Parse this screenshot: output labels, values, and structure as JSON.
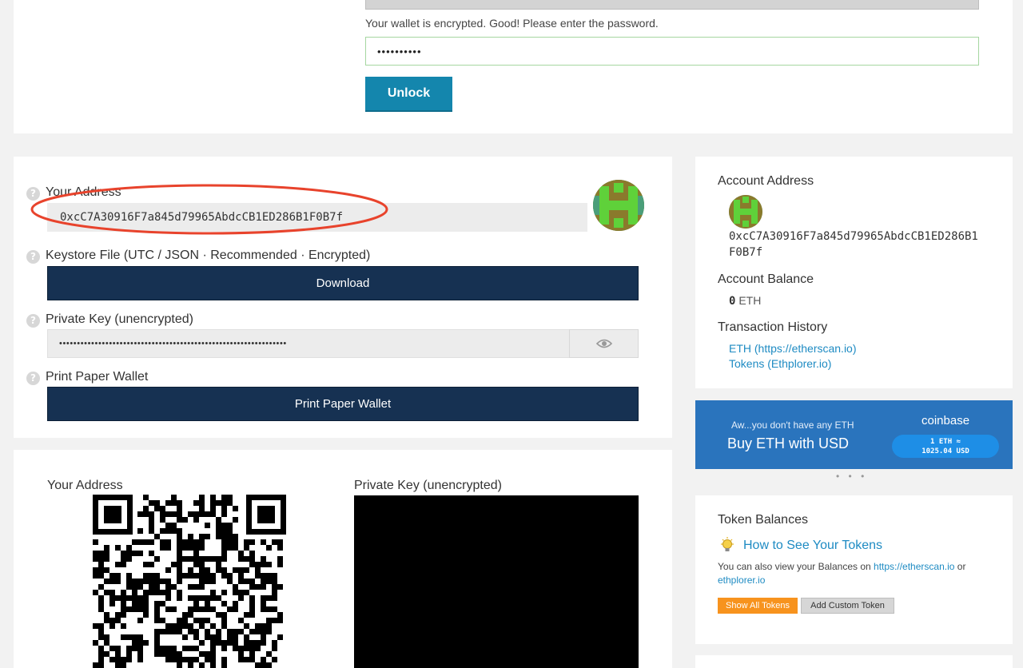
{
  "unlock_section": {
    "encrypted_msg": "Your wallet is encrypted. Good! Please enter the password.",
    "password_mask": "••••••••••",
    "unlock_label": "Unlock"
  },
  "wallet_info": {
    "address_label": "Your Address",
    "address_value": "0xcC7A30916F7a845d79965AbdcCB1ED286B1F0B7f",
    "keystore_label": "Keystore File (UTC / JSON · Recommended · Encrypted)",
    "download_label": "Download",
    "private_key_label": "Private Key (unencrypted)",
    "private_key_mask": "••••••••••••••••••••••••••••••••••••••••••••••••••••••••••••••••",
    "print_label": "Print Paper Wallet",
    "print_button": "Print Paper Wallet"
  },
  "qr_section": {
    "address_label": "Your Address",
    "private_key_label": "Private Key (unencrypted)"
  },
  "account_sidebar": {
    "address_heading": "Account Address",
    "address_line1": "0xcC7A30916F7a845d79965AbdcCB1ED286B1",
    "address_line2": "F0B7f",
    "balance_heading": "Account Balance",
    "balance_value": "0",
    "balance_unit": "ETH",
    "history_heading": "Transaction History",
    "history_links": [
      "ETH (https://etherscan.io)",
      "Tokens (Ethplorer.io)"
    ]
  },
  "coinbase_banner": {
    "note": "Aw...you don't have any ETH",
    "title": "Buy ETH with USD",
    "brand": "coinbase",
    "rate_line1": "1 ETH ≈",
    "rate_line2": "1025.04 USD",
    "dots": "• • •"
  },
  "token_balances": {
    "heading": "Token Balances",
    "howto_link": "How to See Your Tokens",
    "info_prefix": "You can also view your Balances on",
    "etherscan_link": "https://etherscan.io",
    "info_or": "or",
    "ethplorer_link": "ethplorer.io",
    "show_all": "Show All Tokens",
    "add_custom": "Add Custom Token"
  },
  "colors": {
    "accent": "#1e8bc3",
    "navy": "#163152",
    "unlock_button": "#1486ad",
    "coinbase_blue": "#2a74bd",
    "highlight_ellipse": "#e8432c"
  },
  "icons": [
    "help-icon",
    "eye-icon",
    "lightbulb-icon",
    "identicon"
  ]
}
